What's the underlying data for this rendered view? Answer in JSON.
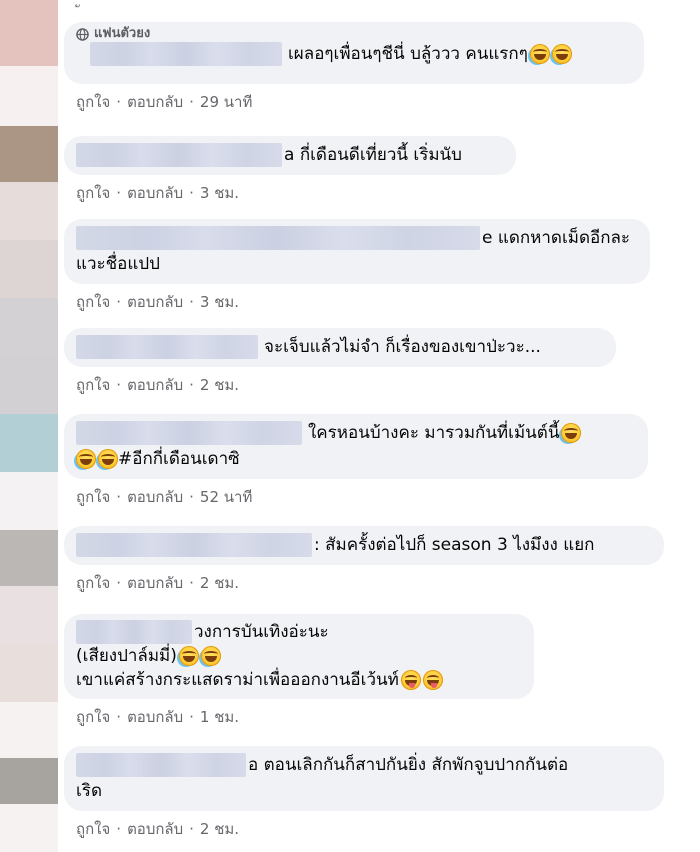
{
  "top_fragment": "ั",
  "avatar_colors": [
    "#e4c3bf",
    "#ab9685",
    "#e6dcd9",
    "#ddd5d3",
    "#d4d1d4",
    "#d2d0d2",
    "#b2cfd6",
    "#bab7b5",
    "#e9e1e1",
    "#e8dedc",
    "#a7a39e",
    "#ebe5e3"
  ],
  "comments": [
    {
      "badge": "แฟนตัวยง",
      "lines": [
        "เผลอๆเพื่อนๆชีนี่ บลู้ววว คนแรกๆ"
      ],
      "emoji_after_line": [
        2
      ],
      "likes_label": "ถูกใจ",
      "reply_label": "ตอบกลับ",
      "time": "29 นาที"
    },
    {
      "lines": [
        "a กี่เดือนดีเที่ยวนี้ เริ่มนับ"
      ],
      "likes_label": "ถูกใจ",
      "reply_label": "ตอบกลับ",
      "time": "3 ชม."
    },
    {
      "lines": [
        "e แดกหาดเม็ดอีกละ",
        "แวะชื่อแปป"
      ],
      "likes_label": "ถูกใจ",
      "reply_label": "ตอบกลับ",
      "time": "3 ชม."
    },
    {
      "lines": [
        "จะเจ็บแล้วไม่จำ ก็เรื่องของเขาป่ะวะ..."
      ],
      "likes_label": "ถูกใจ",
      "reply_label": "ตอบกลับ",
      "time": "2 ชม."
    },
    {
      "lines": [
        "ใครหอนบ้างคะ มารวมกันที่เม้นต์นี้",
        "#อีกกี่เดือนเดาซิ"
      ],
      "likes_label": "ถูกใจ",
      "reply_label": "ตอบกลับ",
      "time": "52 นาที"
    },
    {
      "lines": [
        ": สัมครั้งต่อไปก็ season 3 ไงมึงง แยก"
      ],
      "likes_label": "ถูกใจ",
      "reply_label": "ตอบกลับ",
      "time": "2 ชม."
    },
    {
      "lines": [
        "วงการบันเทิงอ่ะนะ",
        "(เสียงปาล์มมี่)",
        "เขาแค่สร้างกระแสดราม่าเพื่อออกงานอีเว้นท์"
      ],
      "likes_label": "ถูกใจ",
      "reply_label": "ตอบกลับ",
      "time": "1 ชม."
    },
    {
      "lines": [
        "อ ตอนเลิกกันก็สาปกันยิ่ง สักพักจูบปากกันต่อ",
        "เริด"
      ],
      "likes_label": "ถูกใจ",
      "reply_label": "ตอบกลับ",
      "time": "2 ชม."
    }
  ]
}
